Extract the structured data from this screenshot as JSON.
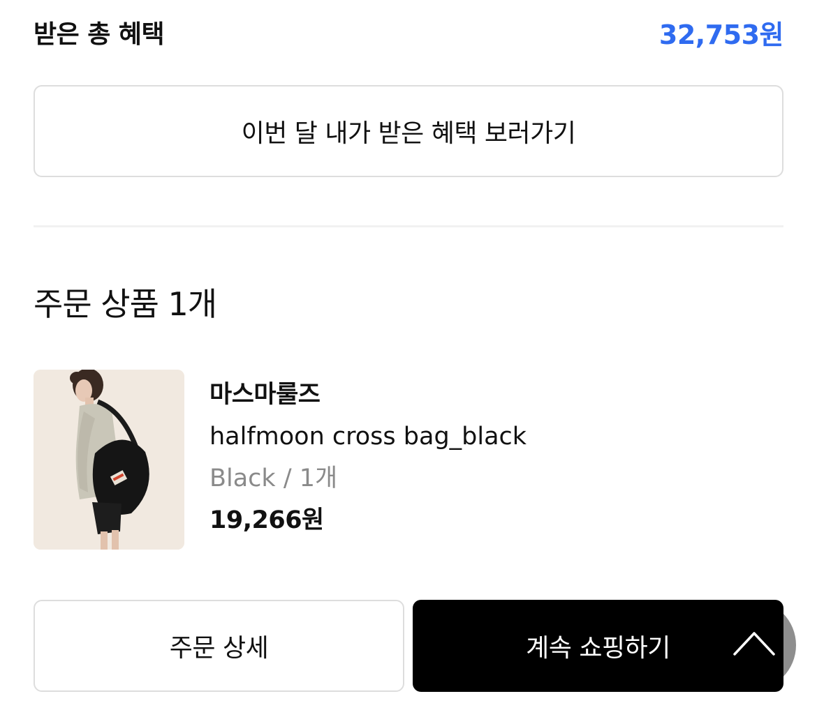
{
  "benefit": {
    "label": "받은 총 혜택",
    "amount": "32,753원",
    "amount_color": "#2f6bf0",
    "view_button_label": "이번 달 내가 받은 혜택 보러가기"
  },
  "order": {
    "section_title": "주문 상품 1개",
    "items": [
      {
        "brand": "마스마룰즈",
        "name": "halfmoon cross bag_black",
        "option": "Black / 1개",
        "price": "19,266원"
      }
    ]
  },
  "actions": {
    "order_detail_label": "주문 상세",
    "continue_shopping_label": "계속 쇼핑하기",
    "scroll_top_icon": "chevron-up-icon"
  },
  "colors": {
    "accent": "#2f6bf0",
    "primary_button": "#000000",
    "border": "#dddddd",
    "muted_text": "#8a8a8a"
  }
}
